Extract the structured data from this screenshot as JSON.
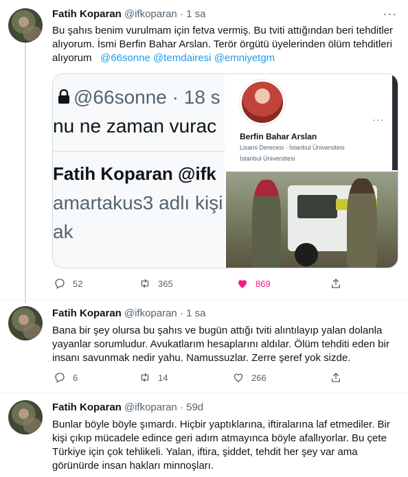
{
  "tweets": [
    {
      "name": "Fatih Koparan",
      "handle_time": "@ifkoparan · 1 sa",
      "text_lines": [
        "Bu şahıs benim vurulmam için fetva vermiş. Bu tviti attığından beri tehditler",
        "alıyorum. İsmi Berfin Bahar Arslan. Terör örgütü üyelerinden ölüm tehditleri",
        "alıyorum"
      ],
      "mentions": "@66sonne @temdairesi @emniyetgm",
      "media": {
        "left_lines": [
          "@66sonne · 18 s",
          "nu ne zaman vurac",
          "Fatih Koparan @ifk",
          "amartakus3 adlı kişi",
          "ak"
        ],
        "profile_name": "Berfin Bahar Arslan",
        "profile_degree": "Lisans Derecesi · İstanbul Üniversitesi",
        "profile_school": "İstanbul Üniversitesi"
      },
      "replies": "52",
      "retweets": "365",
      "likes": "869"
    },
    {
      "name": "Fatih Koparan",
      "handle_time": "@ifkoparan · 1 sa",
      "text_lines": [
        "Bana bir şey olursa bu şahıs ve bugün attığı tviti alıntılayıp yalan dolanla",
        "yayanlar sorumludur. Avukatlarım hesaplarını aldılar. Ölüm tehditi eden bir",
        "insanı savunmak nedir yahu. Namussuzlar. Zerre şeref yok sizde."
      ],
      "replies": "6",
      "retweets": "14",
      "likes": "266"
    },
    {
      "name": "Fatih Koparan",
      "handle_time": "@ifkoparan · 59d",
      "text_lines": [
        "Bunlar böyle böyle şımardı. Hiçbir yaptıklarına, iftiralarına laf etmediler. Bir",
        "kişi çıkıp mücadele edince geri adım atmayınca böyle afallıyorlar. Bu çete",
        "Türkiye için çok tehlikeli. Yalan, iftira, şiddet, tehdit her şey var ama",
        "görünürde insan hakları minnoşları."
      ]
    }
  ],
  "icons": [
    "reply-icon",
    "retweet-icon",
    "like-icon",
    "share-icon",
    "more-icon",
    "lock-icon"
  ],
  "colors": {
    "accent": "#1d9bf0",
    "like": "#f91880",
    "muted": "#536471",
    "text": "#0f1419"
  },
  "more_glyph": "···"
}
